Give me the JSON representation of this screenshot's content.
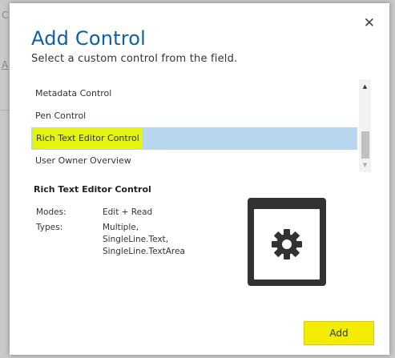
{
  "background": {
    "fragment_1": "C",
    "fragment_2": "A"
  },
  "dialog": {
    "close_glyph": "✕",
    "title": "Add Control",
    "subtitle": "Select a custom control from the field."
  },
  "list": {
    "items": [
      {
        "label": "Metadata Control"
      },
      {
        "label": "Pen Control"
      },
      {
        "label": "Rich Text Editor Control"
      },
      {
        "label": "User Owner Overview"
      }
    ],
    "selected_index": 2,
    "scroll_up_glyph": "▲",
    "scroll_down_glyph": "▼"
  },
  "details": {
    "title": "Rich Text Editor Control",
    "modes_label": "Modes:",
    "modes_value": "Edit + Read",
    "types_label": "Types:",
    "types_values": [
      "Multiple,",
      "SingleLine.Text,",
      "SingleLine.TextArea"
    ],
    "preview_icon": "gear-icon"
  },
  "footer": {
    "add_label": "Add"
  },
  "colors": {
    "title_blue": "#0f5fa8",
    "selected_row": "#b7d7ee",
    "highlight_yellow": "#e3f40f",
    "add_button": "#f4ec00"
  }
}
